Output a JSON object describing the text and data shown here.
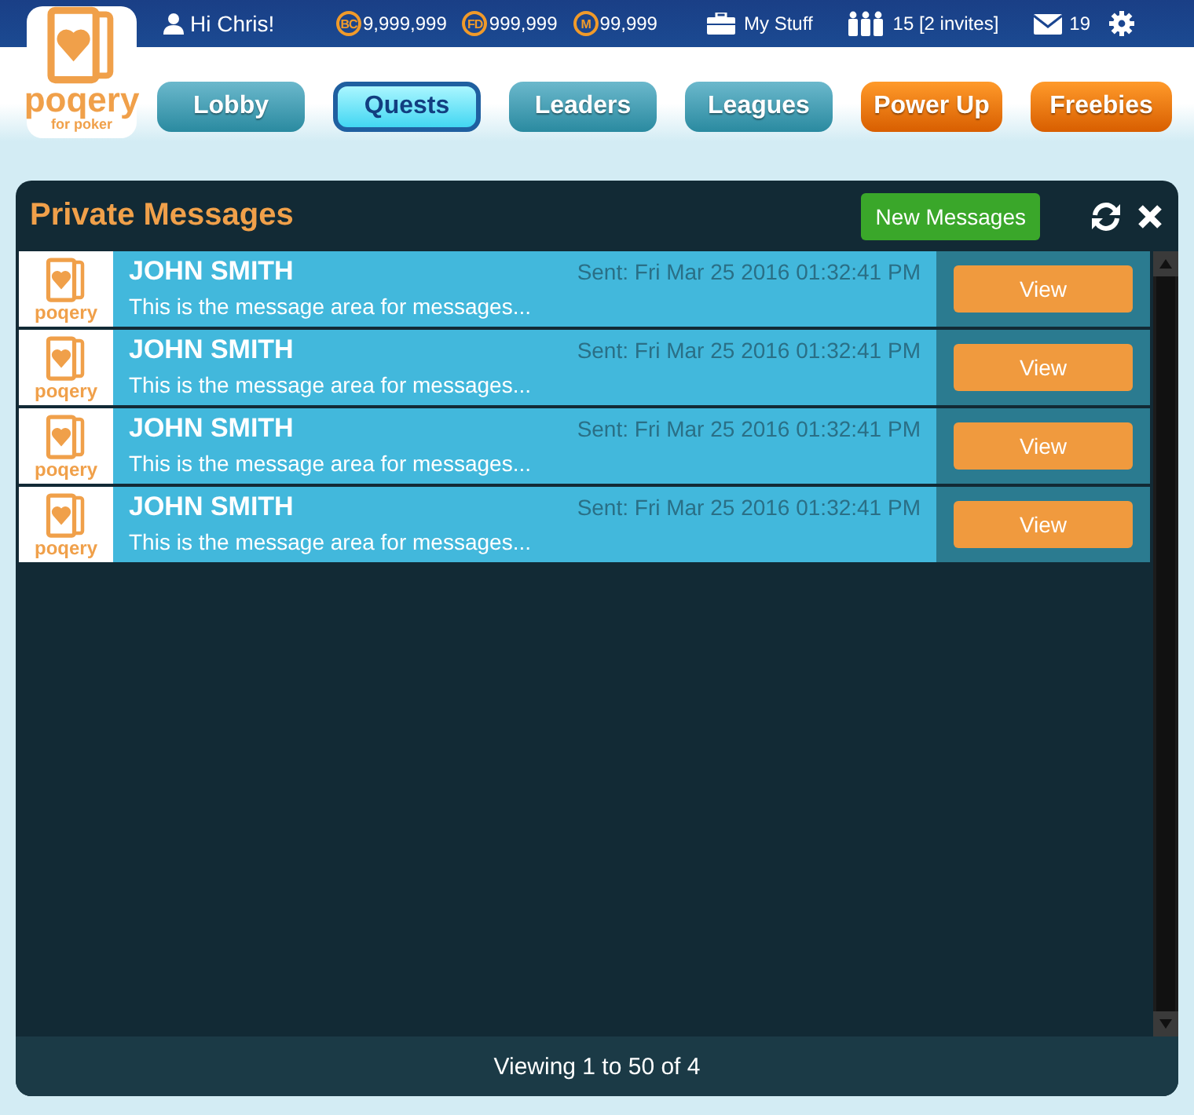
{
  "logo": {
    "name": "poqery",
    "tagline": "for poker"
  },
  "top_bar": {
    "greeting": "Hi Chris!",
    "currencies": [
      {
        "badge": "BC",
        "amount": "9,999,999"
      },
      {
        "badge": "FD",
        "amount": "999,999"
      },
      {
        "badge": "M",
        "amount": "99,999"
      }
    ],
    "my_stuff": "My Stuff",
    "friends": "15 [2 invites]",
    "messages": "19"
  },
  "nav": [
    {
      "label": "Lobby",
      "kind": "teal",
      "selected": false
    },
    {
      "label": "Quests",
      "kind": "teal",
      "selected": true
    },
    {
      "label": "Leaders",
      "kind": "teal",
      "selected": false
    },
    {
      "label": "Leagues",
      "kind": "teal",
      "selected": false
    },
    {
      "label": "Power Up",
      "kind": "orange",
      "selected": false
    },
    {
      "label": "Freebies",
      "kind": "orange",
      "selected": false
    }
  ],
  "panel": {
    "title": "Private Messages",
    "new_button": "New Messages",
    "messages": [
      {
        "logo": "poqery",
        "sender": "JOHN SMITH",
        "sent": "Sent: Fri Mar 25 2016 01:32:41 PM",
        "preview": "This is the message area for messages...",
        "action": "View"
      },
      {
        "logo": "poqery",
        "sender": "JOHN SMITH",
        "sent": "Sent: Fri Mar 25 2016 01:32:41 PM",
        "preview": "This is the message area for messages...",
        "action": "View"
      },
      {
        "logo": "poqery",
        "sender": "JOHN SMITH",
        "sent": "Sent: Fri Mar 25 2016 01:32:41 PM",
        "preview": "This is the message area for messages...",
        "action": "View"
      },
      {
        "logo": "poqery",
        "sender": "JOHN SMITH",
        "sent": "Sent: Fri Mar 25 2016 01:32:41 PM",
        "preview": "This is the message area for messages...",
        "action": "View"
      }
    ],
    "footer": "Viewing 1 to 50 of 4"
  }
}
